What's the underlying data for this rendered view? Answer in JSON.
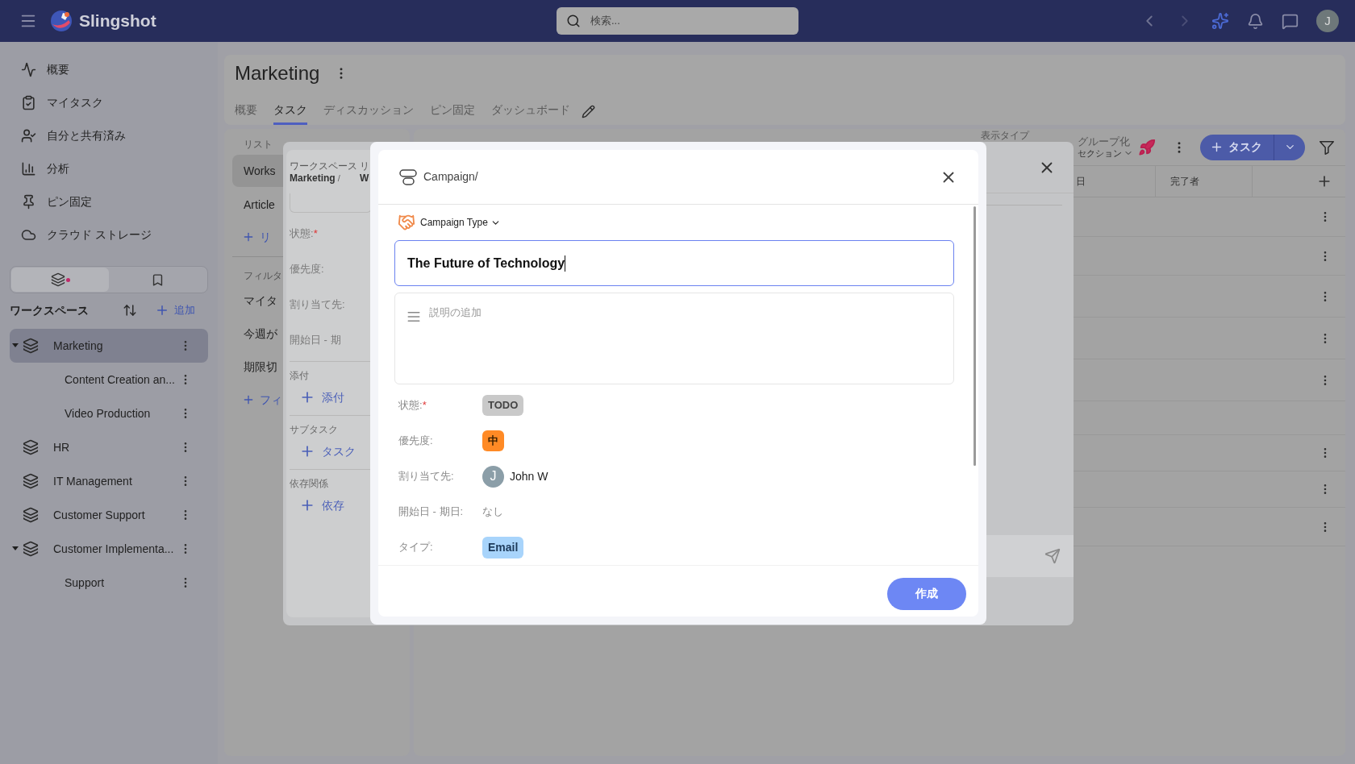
{
  "topbar": {
    "app_name": "Slingshot",
    "search": {
      "placeholder": "検索..."
    },
    "avatar": "J"
  },
  "sidebar": {
    "nav": [
      {
        "label": "概要"
      },
      {
        "label": "マイタスク"
      },
      {
        "label": "自分と共有済み"
      },
      {
        "label": "分析"
      },
      {
        "label": "ピン固定"
      },
      {
        "label": "クラウド ストレージ"
      }
    ],
    "toggle": [
      {
        "selected": true
      },
      {
        "selected": false
      }
    ],
    "workspace_title": "ワークスペース",
    "add_label": "追加",
    "tree": [
      {
        "label": "Marketing",
        "selected": true,
        "expanded": true,
        "children": [
          {
            "label": "Content Creation an...",
            "selected": false
          },
          {
            "label": "Video Production",
            "selected": false
          }
        ]
      },
      {
        "label": "HR",
        "selected": false
      },
      {
        "label": "IT Management",
        "selected": false
      },
      {
        "label": "Customer Support",
        "selected": false
      },
      {
        "label": "Customer Implementa...",
        "selected": false,
        "expanded": true,
        "children": [
          {
            "label": "Support",
            "selected": false
          }
        ]
      }
    ]
  },
  "page": {
    "title": "Marketing",
    "tabs": [
      {
        "label": "概要",
        "selected": false
      },
      {
        "label": "タスク",
        "selected": true
      },
      {
        "label": "ディスカッション",
        "selected": false
      },
      {
        "label": "ピン固定",
        "selected": false
      },
      {
        "label": "ダッシュボード",
        "selected": false
      }
    ]
  },
  "list_panel": {
    "heading": "リスト",
    "lists": [
      {
        "label": "Works",
        "selected": true
      },
      {
        "label": "Article",
        "selected": false
      }
    ],
    "add_list": "リ",
    "filter_heading": "フィルタ",
    "filters": [
      "マイタ",
      "今週が",
      "期限切"
    ],
    "add_filter": "フィ"
  },
  "right_panel": {
    "view_type": "表示タイプ",
    "group_by": "グループ化",
    "grouping": "セクション",
    "add_task": "タスク",
    "columns": [
      "日",
      "完了者"
    ]
  },
  "task_drawer": {
    "breadcrumb": [
      {
        "label": "ワークスペース",
        "value": "Marketing"
      },
      {
        "label": "リ",
        "value": "W"
      }
    ],
    "separator": "/",
    "required_mark": "*",
    "fields": [
      {
        "label": "状態:",
        "required": true
      },
      {
        "label": "優先度:",
        "required": false
      },
      {
        "label": "割り当て先:",
        "required": false
      },
      {
        "label": "開始日 - 期",
        "required": false
      }
    ],
    "sections": [
      {
        "title": "添付",
        "action": "添付"
      },
      {
        "title": "サブタスク",
        "action": "タスク"
      },
      {
        "title": "依存関係",
        "action": "依存"
      }
    ]
  },
  "create_dialog": {
    "breadcrumb": "Campaign/",
    "type_label": "Campaign Type",
    "title_value": "The Future of Technology",
    "description_placeholder": "説明の追加",
    "required_mark": "*",
    "properties": [
      {
        "kind": "status",
        "label": "状態:",
        "required": true,
        "value": "TODO",
        "color": "#c9c9c9"
      },
      {
        "kind": "priority",
        "label": "優先度:",
        "required": false,
        "value": "中",
        "color": "#ff8a25"
      },
      {
        "kind": "assignee",
        "label": "割り当て先:",
        "required": false,
        "value": "John W",
        "initial": "J"
      },
      {
        "kind": "date",
        "label": "開始日 - 期日:",
        "required": false,
        "value": "なし"
      },
      {
        "kind": "type",
        "label": "タイプ:",
        "required": false,
        "value": "Email",
        "color": "#a8d4fb"
      }
    ],
    "submit": "作成"
  }
}
